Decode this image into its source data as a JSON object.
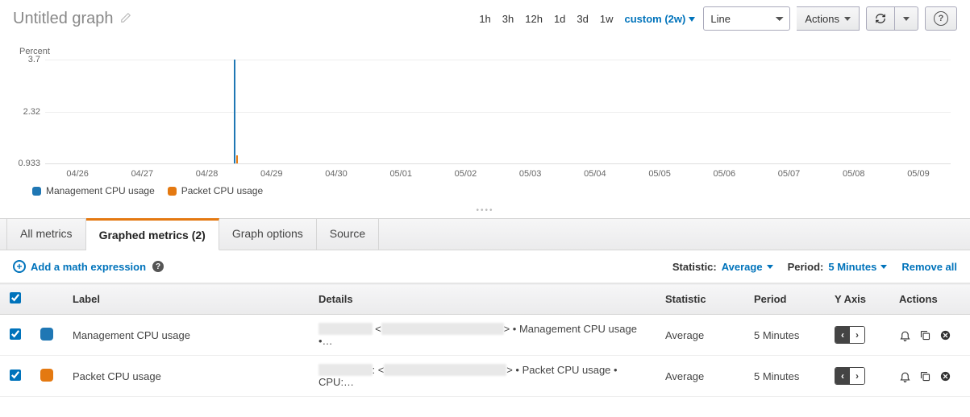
{
  "header": {
    "title": "Untitled graph",
    "ranges": [
      "1h",
      "3h",
      "12h",
      "1d",
      "3d",
      "1w"
    ],
    "custom_label": "custom (2w)",
    "chart_type": "Line",
    "actions_label": "Actions"
  },
  "chart_data": {
    "type": "line",
    "title": "",
    "ylabel": "Percent",
    "yticks": [
      "3.7",
      "2.32",
      "0.933"
    ],
    "ylim": [
      0.933,
      3.7
    ],
    "categories": [
      "04/26",
      "04/27",
      "04/28",
      "04/29",
      "04/30",
      "05/01",
      "05/02",
      "05/03",
      "05/04",
      "05/05",
      "05/06",
      "05/07",
      "05/08",
      "05/09"
    ],
    "series": [
      {
        "name": "Management CPU usage",
        "color": "#1f77b4",
        "values_note": "single spike near 04/28–04/29 reaching ~3.7"
      },
      {
        "name": "Packet CPU usage",
        "color": "#e47911",
        "values_note": "single small spike near 04/28–04/29"
      }
    ]
  },
  "tabs": {
    "all_metrics": "All metrics",
    "graphed_metrics": "Graphed metrics (2)",
    "graph_options": "Graph options",
    "source": "Source"
  },
  "subbar": {
    "add_expr": "Add a math expression",
    "statistic_label": "Statistic:",
    "statistic_value": "Average",
    "period_label": "Period:",
    "period_value": "5 Minutes",
    "remove_all": "Remove all"
  },
  "table": {
    "headers": {
      "label": "Label",
      "details": "Details",
      "statistic": "Statistic",
      "period": "Period",
      "yaxis": "Y Axis",
      "actions": "Actions"
    },
    "rows": [
      {
        "checked": true,
        "color": "blue",
        "label": "Management CPU usage",
        "details_tail": "> • Management CPU usage •…",
        "statistic": "Average",
        "period": "5 Minutes"
      },
      {
        "checked": true,
        "color": "orange",
        "label": "Packet CPU usage",
        "details_tail": "> • Packet CPU usage • CPU:…",
        "statistic": "Average",
        "period": "5 Minutes"
      }
    ]
  }
}
